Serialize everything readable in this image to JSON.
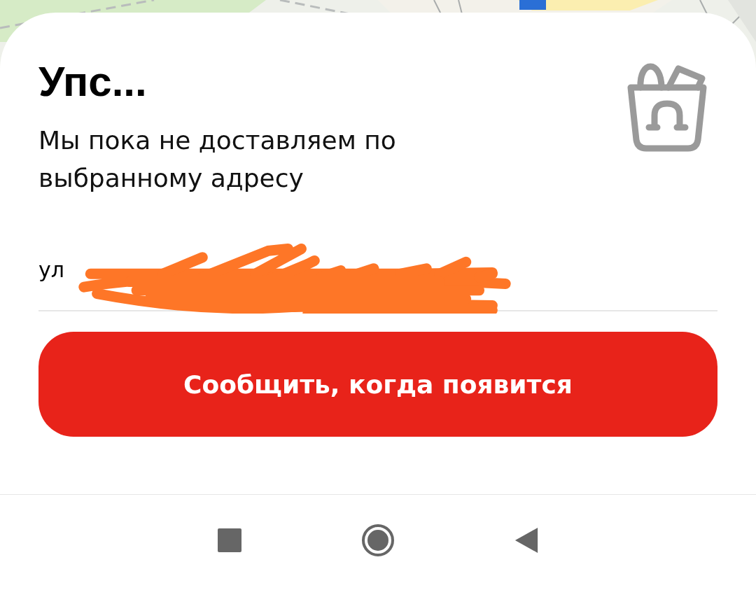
{
  "sheet": {
    "title": "Упс...",
    "message": "Мы пока не доставляем по выбранному адресу",
    "address": "ул",
    "notify_button": "Сообщить, когда появится"
  }
}
